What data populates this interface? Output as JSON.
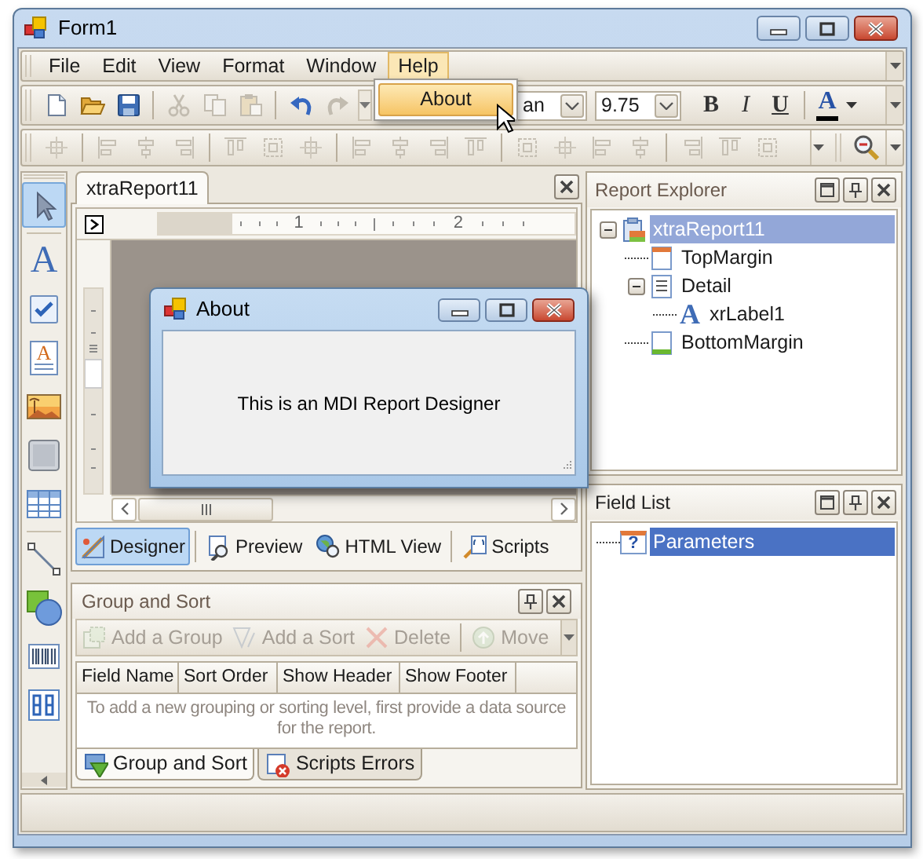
{
  "window": {
    "title": "Form1"
  },
  "menu": [
    {
      "label": "File",
      "selected": false
    },
    {
      "label": "Edit",
      "selected": false
    },
    {
      "label": "View",
      "selected": false
    },
    {
      "label": "Format",
      "selected": false
    },
    {
      "label": "Window",
      "selected": false
    },
    {
      "label": "Help",
      "selected": true
    }
  ],
  "help_menu": [
    {
      "label": "About",
      "selected": true
    }
  ],
  "standard_toolbar": {
    "groups": [
      [
        {
          "kind": "new",
          "disabled": false
        },
        {
          "kind": "open",
          "disabled": false
        },
        {
          "kind": "save",
          "disabled": false
        }
      ],
      [
        {
          "kind": "cut",
          "disabled": true
        },
        {
          "kind": "copy",
          "disabled": true
        },
        {
          "kind": "paste",
          "disabled": true
        }
      ],
      [
        {
          "kind": "undo",
          "disabled": false
        },
        {
          "kind": "redo",
          "disabled": true
        }
      ]
    ],
    "font_name": "an",
    "font_size": "9.75",
    "format_buttons": [
      {
        "glyph": "B",
        "kind": "bold"
      },
      {
        "glyph": "I",
        "kind": "italic"
      },
      {
        "glyph": "U",
        "kind": "underline"
      }
    ],
    "font_color": {
      "glyph": "A",
      "color": "#000000"
    }
  },
  "toolbox": [
    {
      "kind": "pointer",
      "selected": true
    },
    {
      "kind": "label",
      "glyph": "A",
      "selected": false
    },
    {
      "kind": "checkbox",
      "selected": false
    },
    {
      "kind": "richtext",
      "glyph": "A",
      "selected": false
    },
    {
      "kind": "picture",
      "selected": false
    },
    {
      "kind": "panel",
      "selected": false
    },
    {
      "kind": "table",
      "selected": false
    },
    {
      "kind": "line",
      "selected": false
    },
    {
      "kind": "shape",
      "selected": false
    },
    {
      "kind": "barcode",
      "selected": false
    },
    {
      "kind": "digits",
      "selected": false
    }
  ],
  "document": {
    "tab": "xtraReport11",
    "ruler_labels": [
      "1",
      "2"
    ],
    "view_tabs": [
      {
        "label": "Designer",
        "kind": "designer",
        "selected": true
      },
      {
        "label": "Preview",
        "kind": "preview",
        "selected": false
      },
      {
        "label": "HTML View",
        "kind": "html",
        "selected": false
      },
      {
        "label": "Scripts",
        "kind": "scripts",
        "selected": false
      }
    ]
  },
  "about_dialog": {
    "title": "About",
    "message": "This is an MDI Report Designer"
  },
  "report_explorer": {
    "title": "Report Explorer",
    "tree": [
      {
        "label": "xtraReport11",
        "kind": "report",
        "selected": true,
        "expanded": true,
        "children": [
          {
            "label": "TopMargin",
            "kind": "top-margin",
            "selected": false
          },
          {
            "label": "Detail",
            "kind": "detail",
            "selected": false,
            "expanded": true,
            "children": [
              {
                "label": "xrLabel1",
                "kind": "label",
                "glyph": "A",
                "selected": false
              }
            ]
          },
          {
            "label": "BottomMargin",
            "kind": "bottom-margin",
            "selected": false
          }
        ]
      }
    ]
  },
  "field_list": {
    "title": "Field List",
    "tree": [
      {
        "label": "Parameters",
        "kind": "parameters",
        "glyph": "?",
        "selected": true
      }
    ]
  },
  "group_and_sort": {
    "title": "Group and Sort",
    "actions": [
      {
        "label": "Add a Group",
        "kind": "add-group",
        "disabled": true
      },
      {
        "label": "Add a Sort",
        "kind": "add-sort",
        "disabled": true
      },
      {
        "label": "Delete",
        "kind": "delete",
        "disabled": true
      },
      {
        "label": "Move",
        "kind": "move-up",
        "disabled": true
      }
    ],
    "columns": [
      "Field Name",
      "Sort Order",
      "Show Header",
      "Show Footer"
    ],
    "message": "To add a new grouping or sorting level, first provide a data source for the report.",
    "tabs": [
      {
        "label": "Group and Sort",
        "kind": "group-sort",
        "selected": true
      },
      {
        "label": "Scripts Errors",
        "kind": "scripts-errors",
        "selected": false
      }
    ]
  }
}
